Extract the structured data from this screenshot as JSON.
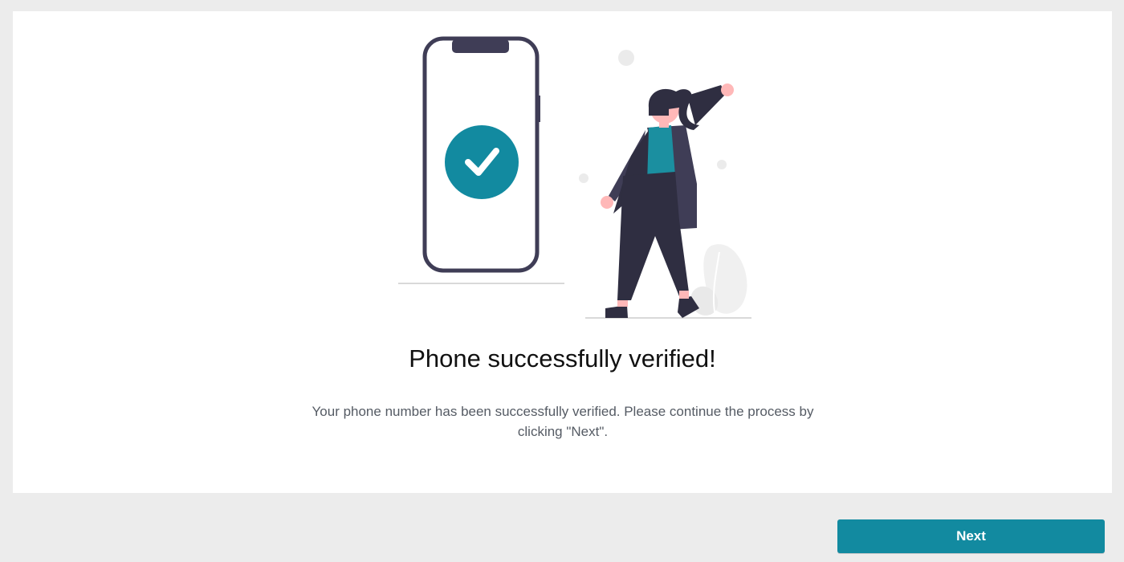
{
  "success": {
    "title": "Phone successfully verified!",
    "message": "Your phone number has been successfully verified. Please continue the process by clicking \"Next\".",
    "illustration_icon": "check-icon"
  },
  "footer": {
    "next_label": "Next"
  },
  "colors": {
    "background": "#ececec",
    "card": "#ffffff",
    "accent": "#128aa0",
    "phone_frame": "#3f3d56",
    "person_dark": "#2f2e41",
    "skin": "#ffb8b8",
    "shirt": "#1b8fa0"
  }
}
